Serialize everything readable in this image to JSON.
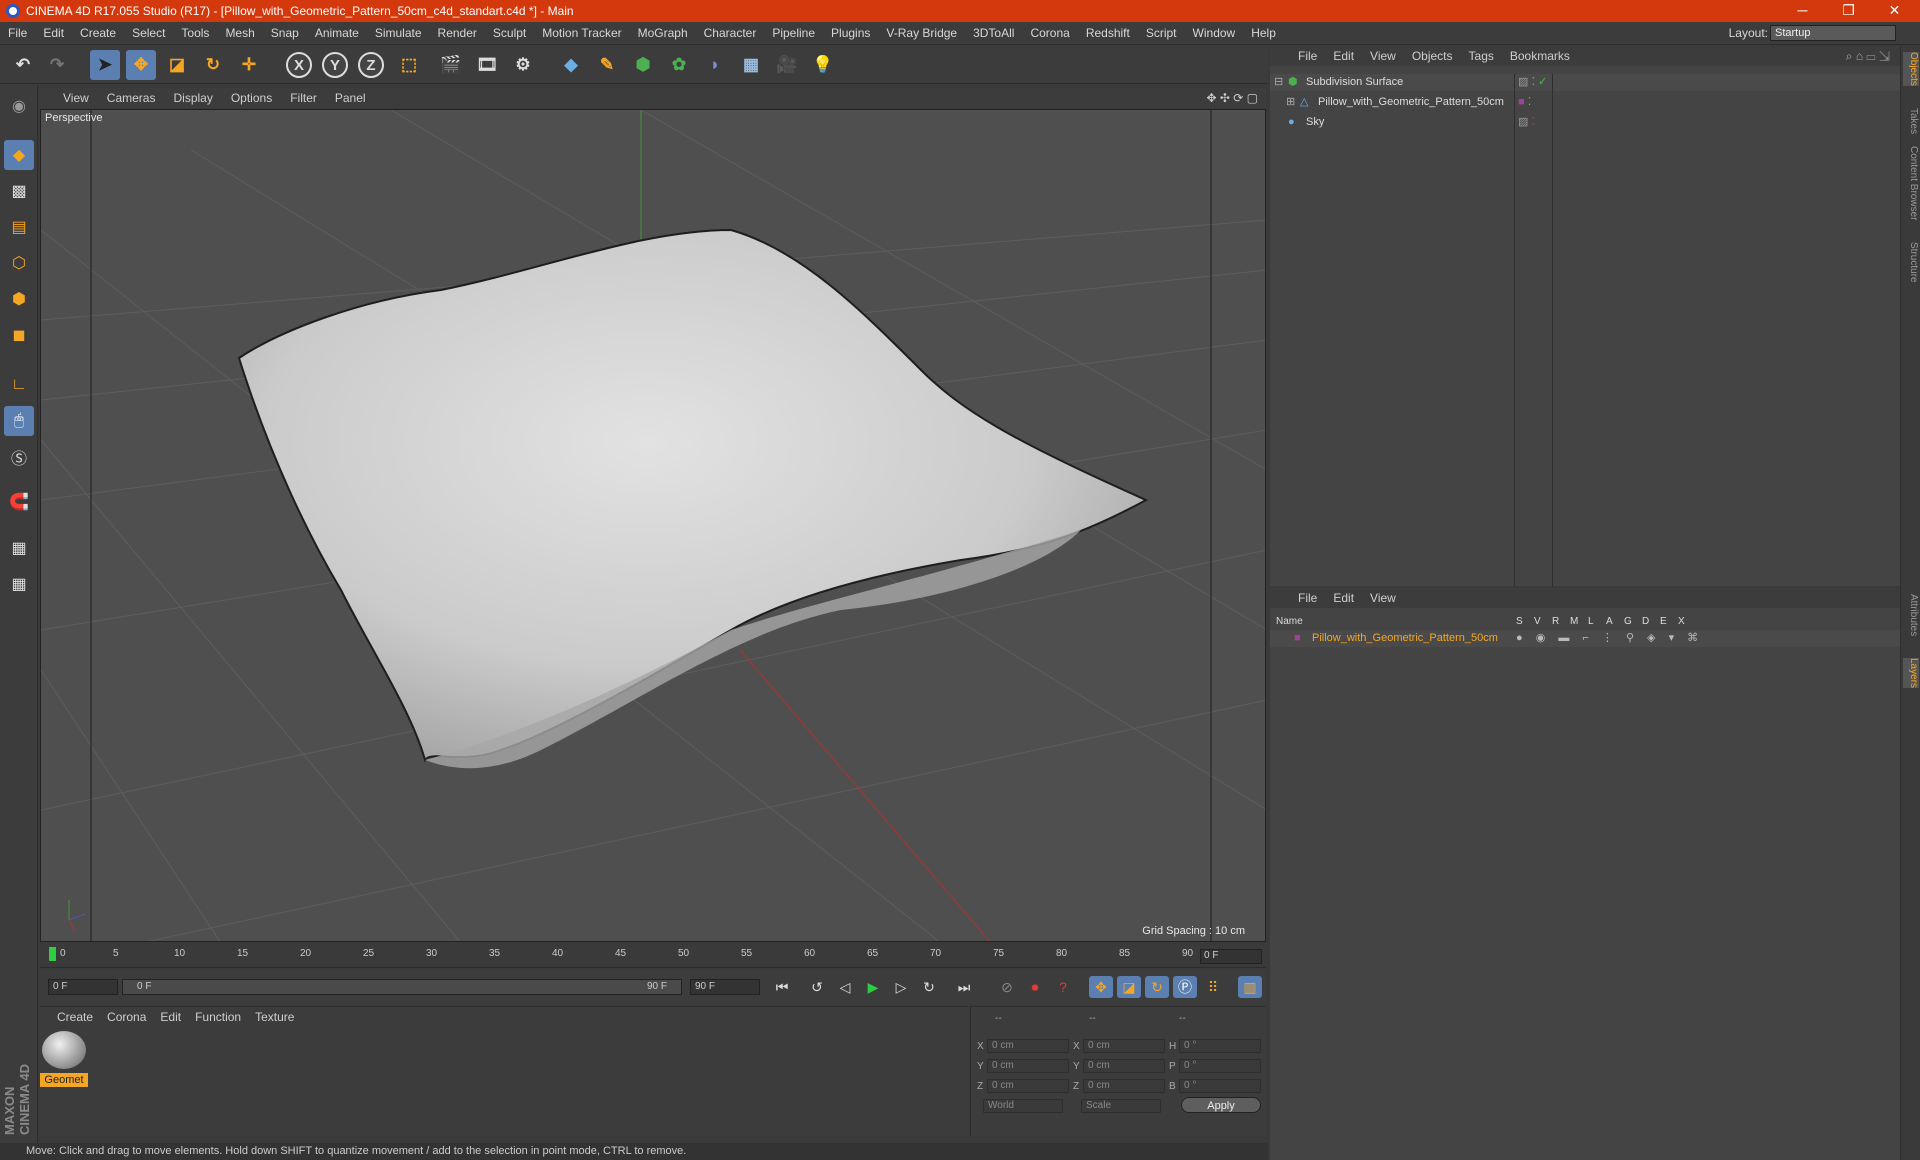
{
  "window": {
    "title": "CINEMA 4D R17.055 Studio (R17) - [Pillow_with_Geometric_Pattern_50cm_c4d_standart.c4d *] - Main",
    "minimize": "─",
    "maximize": "❐",
    "close": "✕"
  },
  "menu": [
    "File",
    "Edit",
    "Create",
    "Select",
    "Tools",
    "Mesh",
    "Snap",
    "Animate",
    "Simulate",
    "Render",
    "Sculpt",
    "Motion Tracker",
    "MoGraph",
    "Character",
    "Pipeline",
    "Plugins",
    "V-Ray Bridge",
    "3DToAll",
    "Corona",
    "Redshift",
    "Script",
    "Window",
    "Help"
  ],
  "layout": {
    "label": "Layout:",
    "value": "Startup"
  },
  "viewport": {
    "menu": [
      "View",
      "Cameras",
      "Display",
      "Options",
      "Filter",
      "Panel"
    ],
    "camera_label": "Perspective",
    "grid_spacing": "Grid Spacing : 10 cm"
  },
  "timeline": {
    "ticks": [
      "0",
      "5",
      "10",
      "15",
      "20",
      "25",
      "30",
      "35",
      "40",
      "45",
      "50",
      "55",
      "60",
      "65",
      "70",
      "75",
      "80",
      "85",
      "90"
    ],
    "current_frame": "0 F",
    "start_field": "0 F",
    "range_start": "0 F",
    "range_end": "90 F",
    "end_field": "90 F"
  },
  "materials": {
    "menu": [
      "Create",
      "Corona",
      "Edit",
      "Function",
      "Texture"
    ],
    "items": [
      {
        "label": "Geomet"
      }
    ]
  },
  "coordinates": {
    "headers": [
      "--",
      "--",
      "--"
    ],
    "rows": [
      {
        "a": "X",
        "v1": "0 cm",
        "b": "X",
        "v2": "0 cm",
        "c": "H",
        "v3": "0 °"
      },
      {
        "a": "Y",
        "v1": "0 cm",
        "b": "Y",
        "v2": "0 cm",
        "c": "P",
        "v3": "0 °"
      },
      {
        "a": "Z",
        "v1": "0 cm",
        "b": "Z",
        "v2": "0 cm",
        "c": "B",
        "v3": "0 °"
      }
    ],
    "world": "World",
    "scale": "Scale",
    "apply": "Apply"
  },
  "status": "Move: Click and drag to move elements. Hold down SHIFT to quantize movement / add to the selection in point mode, CTRL to remove.",
  "objects": {
    "menu": [
      "File",
      "Edit",
      "View",
      "Objects",
      "Tags",
      "Bookmarks"
    ],
    "tree": [
      {
        "name": "Subdivision Surface",
        "indent": 0
      },
      {
        "name": "Pillow_with_Geometric_Pattern_50cm",
        "indent": 1
      },
      {
        "name": "Sky",
        "indent": 0
      }
    ]
  },
  "layers": {
    "menu": [
      "File",
      "Edit",
      "View"
    ],
    "header_name": "Name",
    "columns": [
      "S",
      "V",
      "R",
      "M",
      "L",
      "A",
      "G",
      "D",
      "E",
      "X"
    ],
    "rows": [
      {
        "name": "Pillow_with_Geometric_Pattern_50cm"
      }
    ]
  },
  "side_tabs": [
    "Objects",
    "Takes",
    "Content Browser",
    "Structure",
    "Attributes",
    "Layers"
  ],
  "brand": "MAXON CINEMA 4D",
  "colors": {
    "accent": "#d4380d",
    "selection": "#5b7fb0",
    "layer_text": "#f5a623"
  }
}
